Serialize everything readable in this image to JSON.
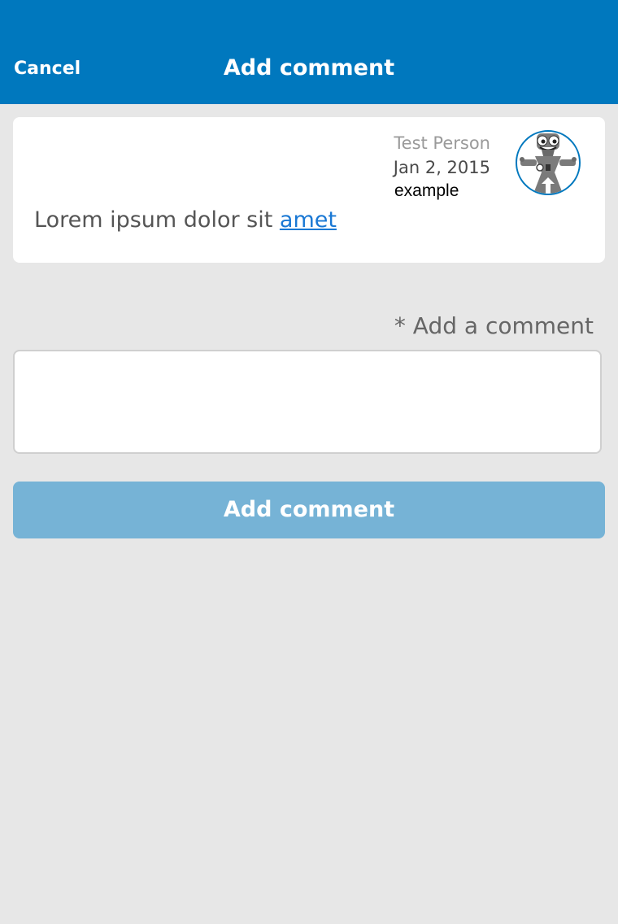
{
  "header": {
    "cancel_label": "Cancel",
    "title": "Add comment",
    "background_color": "#0078be"
  },
  "comment": {
    "author": "Test Person",
    "date": "Jan 2, 2015",
    "source": "example",
    "text_prefix": "Lorem ipsum dolor sit ",
    "link_text": "amet",
    "avatar_icon": "robot-avatar-icon"
  },
  "form": {
    "label": "* Add a comment",
    "value": "",
    "placeholder": "",
    "submit_label": "Add comment",
    "submit_color": "#76b3d6"
  }
}
